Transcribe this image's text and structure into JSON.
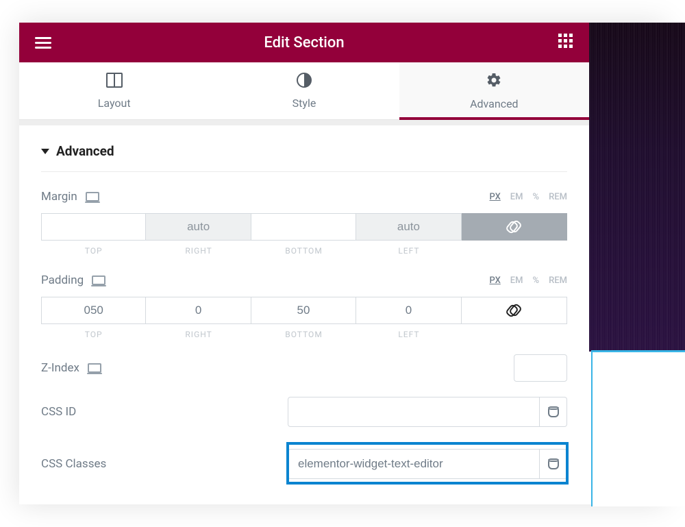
{
  "header": {
    "title": "Edit Section"
  },
  "tabs": {
    "layout": "Layout",
    "style": "Style",
    "advanced": "Advanced"
  },
  "section": {
    "title": "Advanced"
  },
  "units": {
    "px": "PX",
    "em": "EM",
    "pct": "%",
    "rem": "REM"
  },
  "margin": {
    "label": "Margin",
    "top": "",
    "right": "auto",
    "bottom": "",
    "left": "auto",
    "sub": {
      "top": "TOP",
      "right": "RIGHT",
      "bottom": "BOTTOM",
      "left": "LEFT"
    }
  },
  "padding": {
    "label": "Padding",
    "top": "050",
    "right": "0",
    "bottom": "50",
    "left": "0",
    "sub": {
      "top": "TOP",
      "right": "RIGHT",
      "bottom": "BOTTOM",
      "left": "LEFT"
    }
  },
  "zindex": {
    "label": "Z-Index",
    "value": ""
  },
  "cssid": {
    "label": "CSS ID",
    "value": ""
  },
  "cssclasses": {
    "label": "CSS Classes",
    "value": "elementor-widget-text-editor"
  }
}
